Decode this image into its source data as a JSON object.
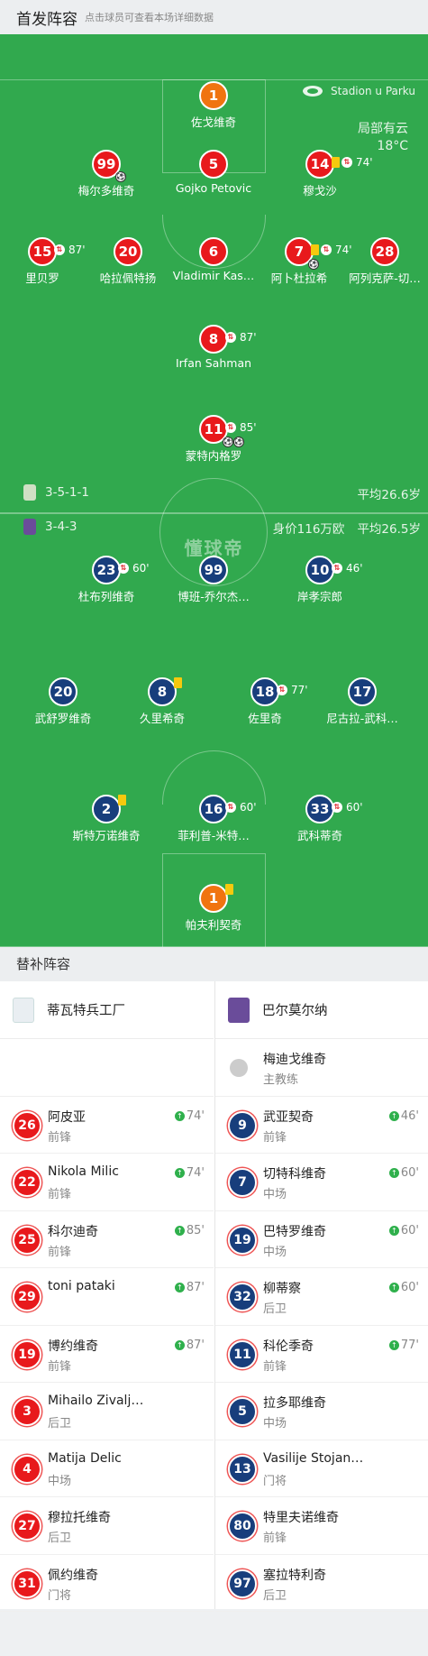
{
  "header": {
    "title": "首发阵容",
    "subtitle": "点击球员可查看本场详细数据"
  },
  "venue": "Stadion u Parku",
  "weather": {
    "condition": "局部有云",
    "temp": "18°C"
  },
  "watermark": "懂球帝",
  "home_team": {
    "formation": "3-5-1-1",
    "avg_age": "平均26.6岁",
    "color": "#e8191c"
  },
  "away_team": {
    "formation": "3-4-3",
    "value": "身价116万欧",
    "avg_age": "平均26.5岁",
    "color": "#183e7c"
  },
  "home_players": [
    {
      "num": "1",
      "name": "佐戈维奇",
      "kit": "org",
      "sub": null
    },
    {
      "num": "99",
      "name": "梅尔多维奇",
      "kit": "red",
      "goals": 1
    },
    {
      "num": "5",
      "name": "Gojko Petovic",
      "kit": "red"
    },
    {
      "num": "14",
      "name": "穆戈沙",
      "kit": "red",
      "yellow": true,
      "sub": "74'"
    },
    {
      "num": "15",
      "name": "里贝罗",
      "kit": "red",
      "sub": "87'"
    },
    {
      "num": "20",
      "name": "哈拉佩特扬",
      "kit": "red"
    },
    {
      "num": "6",
      "name": "Vladimir Kas…",
      "kit": "red"
    },
    {
      "num": "7",
      "name": "阿卜杜拉希",
      "kit": "red",
      "yellow": true,
      "sub": "74'",
      "goals": 1
    },
    {
      "num": "28",
      "name": "阿列克萨-切…",
      "kit": "red"
    },
    {
      "num": "8",
      "name": "Irfan Sahman",
      "kit": "red",
      "sub": "87'"
    },
    {
      "num": "11",
      "name": "蒙特内格罗",
      "kit": "red",
      "sub": "85'",
      "goals": 2
    }
  ],
  "away_players": [
    {
      "num": "23",
      "name": "杜布列维奇",
      "kit": "blu",
      "sub": "60'"
    },
    {
      "num": "99",
      "name": "博班-乔尔杰…",
      "kit": "blu"
    },
    {
      "num": "10",
      "name": "岸孝宗郎",
      "kit": "blu",
      "sub": "46'"
    },
    {
      "num": "20",
      "name": "武舒罗维奇",
      "kit": "blu"
    },
    {
      "num": "8",
      "name": "久里希奇",
      "kit": "blu",
      "yellow": true
    },
    {
      "num": "18",
      "name": "佐里奇",
      "kit": "blu",
      "sub": "77'"
    },
    {
      "num": "17",
      "name": "尼古拉-武科…",
      "kit": "blu"
    },
    {
      "num": "2",
      "name": "斯特万诺维奇",
      "kit": "blu",
      "yellow": true
    },
    {
      "num": "16",
      "name": "菲利普-米特…",
      "kit": "blu",
      "sub": "60'"
    },
    {
      "num": "33",
      "name": "武科蒂奇",
      "kit": "blu",
      "sub": "60'"
    },
    {
      "num": "1",
      "name": "帕夫利契奇",
      "kit": "org",
      "yellow": true
    }
  ],
  "bench_title": "替补阵容",
  "bench_home": {
    "team": "蒂瓦特兵工厂",
    "players": [
      {
        "num": "26",
        "name": "阿皮亚",
        "pos": "前锋",
        "time": "74'"
      },
      {
        "num": "22",
        "name": "Nikola Milic",
        "pos": "前锋",
        "time": "74'"
      },
      {
        "num": "25",
        "name": "科尔迪奇",
        "pos": "前锋",
        "time": "85'"
      },
      {
        "num": "29",
        "name": "toni pataki",
        "pos": "",
        "time": "87'"
      },
      {
        "num": "19",
        "name": "博约维奇",
        "pos": "前锋",
        "time": "87'"
      },
      {
        "num": "3",
        "name": "Mihailo Zivalj…",
        "pos": "后卫",
        "time": ""
      },
      {
        "num": "4",
        "name": "Matija Delic",
        "pos": "中场",
        "time": ""
      },
      {
        "num": "27",
        "name": "穆拉托维奇",
        "pos": "后卫",
        "time": ""
      },
      {
        "num": "31",
        "name": "佩约维奇",
        "pos": "门将",
        "time": ""
      }
    ]
  },
  "bench_away": {
    "team": "巴尔莫尔纳",
    "coach": {
      "name": "梅迪戈维奇",
      "role": "主教练"
    },
    "players": [
      {
        "num": "9",
        "name": "武亚契奇",
        "pos": "前锋",
        "time": "46'"
      },
      {
        "num": "7",
        "name": "切特科维奇",
        "pos": "中场",
        "time": "60'"
      },
      {
        "num": "19",
        "name": "巴特罗维奇",
        "pos": "中场",
        "time": "60'"
      },
      {
        "num": "32",
        "name": "柳蒂察",
        "pos": "后卫",
        "time": "60'"
      },
      {
        "num": "11",
        "name": "科伦季奇",
        "pos": "前锋",
        "time": "77'"
      },
      {
        "num": "5",
        "name": "拉多耶维奇",
        "pos": "中场",
        "time": ""
      },
      {
        "num": "13",
        "name": "Vasilije Stojan…",
        "pos": "门将",
        "time": ""
      },
      {
        "num": "80",
        "name": "特里夫诺维奇",
        "pos": "前锋",
        "time": ""
      },
      {
        "num": "97",
        "name": "塞拉特利奇",
        "pos": "后卫",
        "time": ""
      }
    ]
  }
}
